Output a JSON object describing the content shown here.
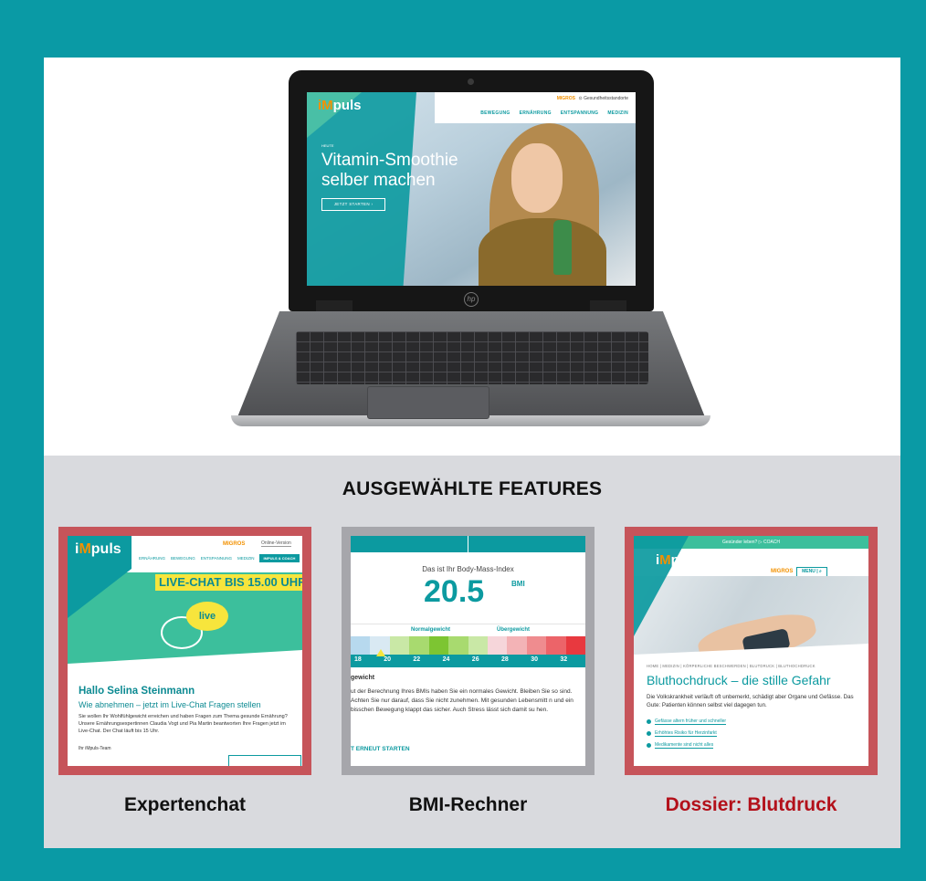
{
  "hero": {
    "screen": {
      "logo_pre": "i",
      "logo_accent": "M",
      "logo_post": "puls",
      "migros": "MIGROS",
      "gesundheit": "Gesundheitsstandorte",
      "nav": [
        "BEWEGUNG",
        "ERNÄHRUNG",
        "ENTSPANNUNG",
        "MEDIZIN"
      ],
      "kicker": "HEUTE",
      "headline": "Vitamin-Smoothie selber machen",
      "cta": "JETZT STARTEN"
    }
  },
  "features": {
    "title": "AUSGEWÄHLTE FEATURES",
    "items": [
      {
        "caption": "Expertenchat"
      },
      {
        "caption": "BMI-Rechner"
      },
      {
        "caption": "Dossier: Blutdruck"
      }
    ]
  },
  "chat": {
    "migros": "MIGROS",
    "online": "Online-Version",
    "nav": [
      "ERNÄHRUNG",
      "BEWEGUNG",
      "ENTSPANNUNG",
      "MEDIZIN"
    ],
    "nav_button": "IMPULS & COACH",
    "banner": "LIVE-CHAT BIS 15.00 UHR",
    "bubble": "live",
    "greeting": "Hallo Selina Steinmann",
    "subtitle": "Wie abnehmen – jetzt im Live-Chat Fragen stellen",
    "body": "Sie wollen Ihr Wohlfühlgewicht erreichen und haben Fragen zum Thema gesunde Ernährung? Unsere Ernährungsexpertinnen Claudia Vogt und Pia Martin beantworten Ihre Fragen jetzt im Live-Chat. Der Chat läuft bis 15 Uhr.",
    "sign": "Ihr iMpuls-Team"
  },
  "bmi": {
    "label": "Das ist Ihr Body-Mass-Index",
    "value": "20.5",
    "unit": "BMI",
    "normal": "Normalgewicht",
    "ueber": "Übergewicht",
    "ticks": [
      "18",
      "20",
      "22",
      "24",
      "26",
      "28",
      "30",
      "32"
    ],
    "colors": [
      "#b7d9ee",
      "#d9e9f3",
      "#c9e8a6",
      "#a8da6f",
      "#7dc532",
      "#a8da6f",
      "#c9e8a6",
      "#f6d6da",
      "#f3b3b6",
      "#ef8c8f",
      "#ec6469",
      "#e8393f"
    ],
    "heading": "gewicht",
    "body": "ut der Berechnung Ihres BMIs haben Sie ein normales Gewicht. Bleiben Sie so sind. Achten Sie nur darauf, dass Sie nicht zunehmen. Mit gesunden Lebensmitt n und ein bisschen Bewegung klappt das sicher. Auch Stress lässt sich damit su hen.",
    "restart": "T ERNEUT STARTEN"
  },
  "dossier": {
    "top": "Gesünder leben? ▷ COACH",
    "migros": "MIGROS",
    "menu": "MENU | ⌕",
    "breadcrumb": "HOME | MEDIZIN | KÖRPERLICHE BESCHWERDEN | BLUTDRUCK | BLUTHOCHDRUCK",
    "title": "Bluthochdruck – die stille Gefahr",
    "body": "Die Volkskrankheit verläuft oft unbemerkt, schädigt aber Organe und Gefässe. Das Gute: Patienten können selbst viel dagegen tun.",
    "links": [
      "Gefässe altern früher und schneller",
      "Erhöhtes Risiko für Herzinfarkt",
      "Medikamente sind nicht alles"
    ]
  }
}
